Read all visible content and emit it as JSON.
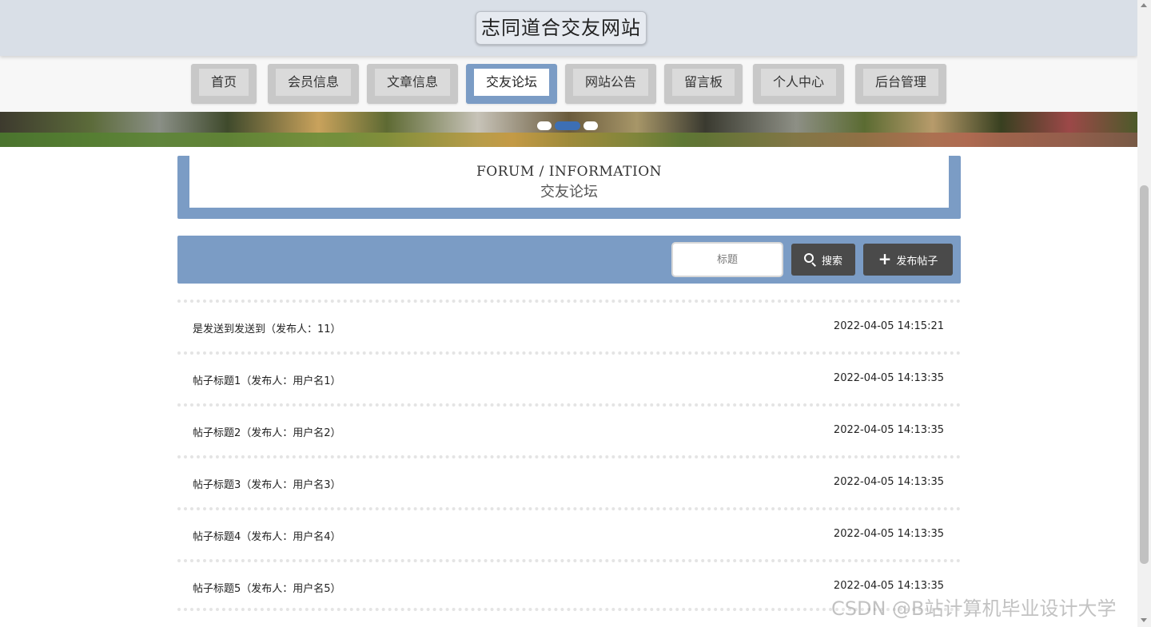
{
  "header": {
    "site_title": "志同道合交友网站"
  },
  "nav": {
    "items": [
      {
        "label": "首页",
        "active": false
      },
      {
        "label": "会员信息",
        "active": false
      },
      {
        "label": "文章信息",
        "active": false
      },
      {
        "label": "交友论坛",
        "active": true
      },
      {
        "label": "网站公告",
        "active": false
      },
      {
        "label": "留言板",
        "active": false
      },
      {
        "label": "个人中心",
        "active": false
      },
      {
        "label": "后台管理",
        "active": false
      }
    ]
  },
  "carousel": {
    "slide_count": 3,
    "active_index": 1
  },
  "section": {
    "en_title": "FORUM / INFORMATION",
    "cn_title": "交友论坛"
  },
  "toolbar": {
    "search_placeholder": "标题",
    "search_label": "搜索",
    "publish_label": "发布帖子"
  },
  "posts": [
    {
      "title": "是发送到发送到（发布人：11）",
      "date": "2022-04-05 14:15:21"
    },
    {
      "title": "帖子标题1（发布人：用户名1）",
      "date": "2022-04-05 14:13:35"
    },
    {
      "title": "帖子标题2（发布人：用户名2）",
      "date": "2022-04-05 14:13:35"
    },
    {
      "title": "帖子标题3（发布人：用户名3）",
      "date": "2022-04-05 14:13:35"
    },
    {
      "title": "帖子标题4（发布人：用户名4）",
      "date": "2022-04-05 14:13:35"
    },
    {
      "title": "帖子标题5（发布人：用户名5）",
      "date": "2022-04-05 14:13:35"
    }
  ],
  "watermark": "CSDN @B站计算机毕业设计大学",
  "colors": {
    "accent": "#7b9cc5",
    "header_bg": "#d9dfe7",
    "button_bg": "#4a4a4a",
    "dot_active": "#3d6fb4"
  }
}
